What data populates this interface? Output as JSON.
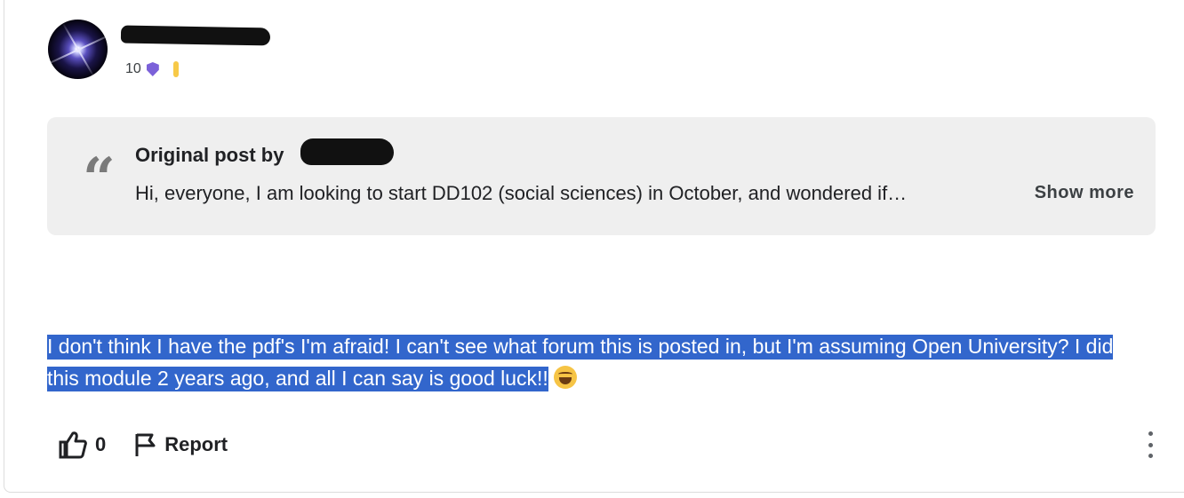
{
  "post": {
    "author_level": "10",
    "quote": {
      "title": "Original post by",
      "excerpt": "Hi, everyone, I am looking to start DD102 (social sciences) in October, and wondered if…",
      "show_more_label": "Show more"
    },
    "reply_text": "I don't think I have the pdf's I'm afraid! I can't see what forum this is posted in, but I'm assuming Open University? I did this module 2 years ago, and all I can say is good luck!!",
    "emoji": "laughing-tears-emoji",
    "actions": {
      "like_count": "0",
      "report_label": "Report"
    }
  },
  "colors": {
    "selection_highlight": "#3266cc",
    "badge_shield": "#7b61d9",
    "badge_pill": "#f7c948",
    "quote_bg": "#efefef"
  }
}
